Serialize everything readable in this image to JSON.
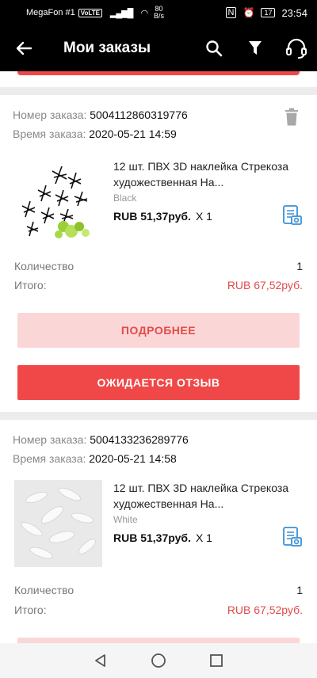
{
  "status_bar": {
    "carrier": "MegaFon #1",
    "volte": "VoLTE",
    "speed_value": "80",
    "speed_unit": "B/s",
    "battery": "17",
    "time": "23:54"
  },
  "app_bar": {
    "title": "Мои заказы"
  },
  "labels": {
    "order_number": "Номер заказа:",
    "order_time": "Время заказа:",
    "quantity": "Количество",
    "total": "Итого:",
    "details_button": "ПОДРОБНЕЕ",
    "review_button": "ОЖИДАЕТСЯ ОТЗЫВ"
  },
  "orders": [
    {
      "number": "5004112860319776",
      "time": "2020-05-21 14:59",
      "item_name": "12 шт. ПВХ 3D наклейка Стрекоза художественная На...",
      "item_color": "Black",
      "item_price": "RUB 51,37руб.",
      "item_qty": "X 1",
      "quantity": "1",
      "total": "RUB 67,52руб."
    },
    {
      "number": "5004133236289776",
      "time": "2020-05-21 14:58",
      "item_name": "12 шт. ПВХ 3D наклейка Стрекоза художественная На...",
      "item_color": "White",
      "item_price": "RUB 51,37руб.",
      "item_qty": "X 1",
      "quantity": "1",
      "total": "RUB 67,52руб."
    }
  ],
  "colors": {
    "accent": "#f04848",
    "accent_light": "#fbd6d6",
    "price_red": "#e24b4b",
    "icon_blue": "#3b8fd6"
  },
  "icons": [
    "back-arrow-icon",
    "search-icon",
    "filter-icon",
    "headset-icon",
    "trash-icon",
    "photo-review-icon",
    "nav-back-icon",
    "nav-home-icon",
    "nav-recents-icon"
  ]
}
